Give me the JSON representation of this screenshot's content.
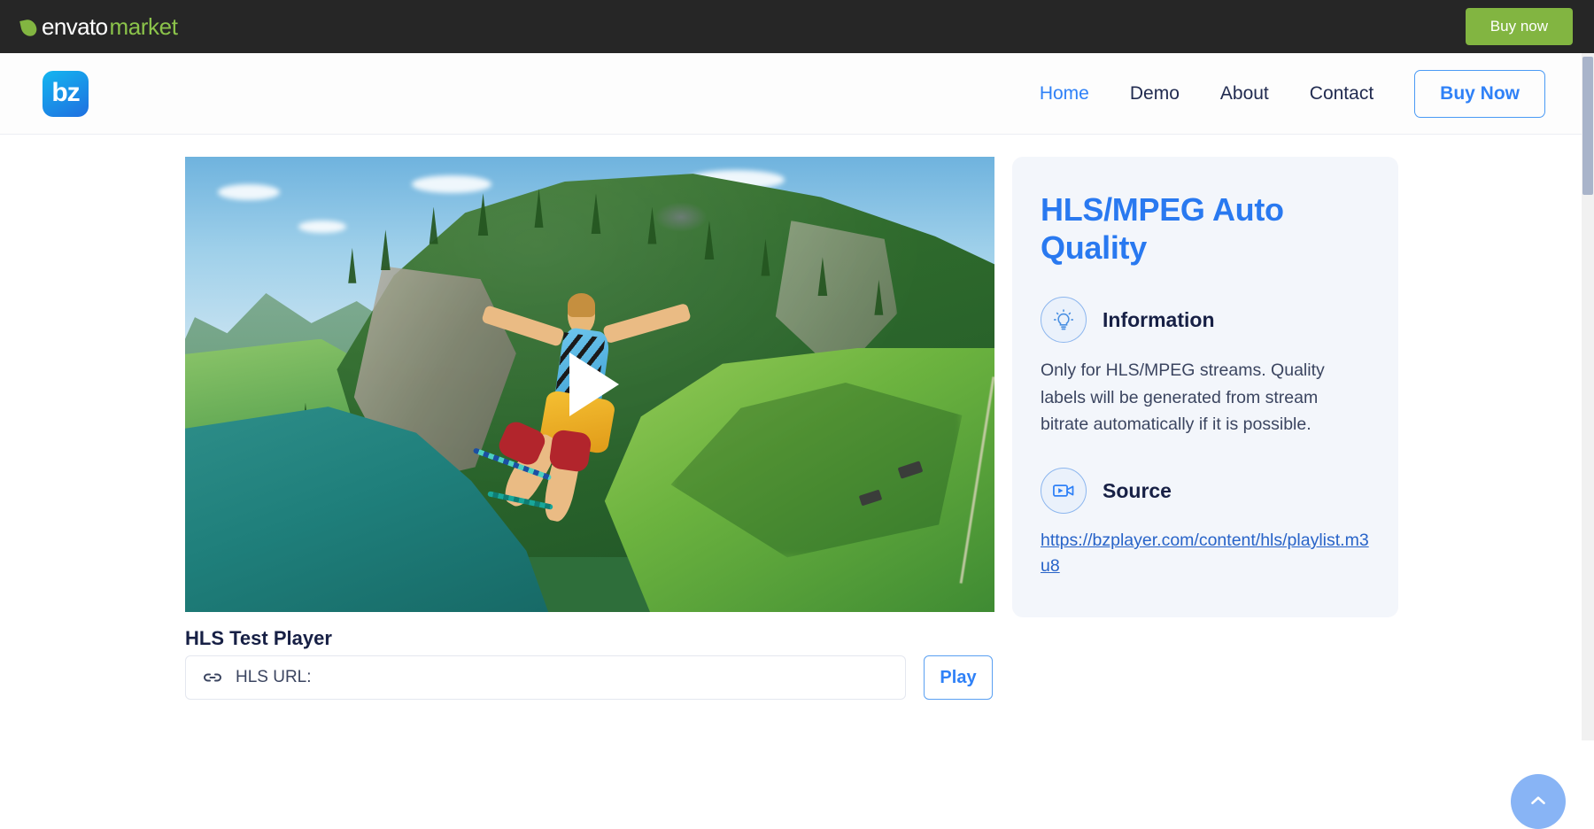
{
  "envato_bar": {
    "logo_word_1": "envato",
    "logo_word_2": "market",
    "logo_icon": "leaf-icon",
    "buy_now_label": "Buy now",
    "background_color": "#262626",
    "accent_color": "#82b541"
  },
  "header": {
    "brand_logo_text": "bz",
    "brand_logo_icon": "bz-logo-icon",
    "nav": [
      {
        "label": "Home",
        "active": true
      },
      {
        "label": "Demo",
        "active": false
      },
      {
        "label": "About",
        "active": false
      },
      {
        "label": "Contact",
        "active": false
      }
    ],
    "buy_now_label": "Buy Now",
    "accent_color": "#2f81f7",
    "text_color": "#212b50"
  },
  "video": {
    "alt": "bungee jumper over alpine lake",
    "play_icon": "play-triangle-icon"
  },
  "test_player": {
    "title": "HLS Test Player",
    "url_icon": "link-icon",
    "url_placeholder": "HLS URL:",
    "url_value": "",
    "play_button_label": "Play"
  },
  "info_panel": {
    "title": "HLS/MPEG Auto Quality",
    "title_color": "#2979f0",
    "background_color": "#f3f6fb",
    "sections": [
      {
        "icon": "lightbulb-icon",
        "label": "Information",
        "body": "Only for HLS/MPEG streams. Quality labels will be generated from stream bitrate automatically if it is possible."
      },
      {
        "icon": "video-camera-icon",
        "label": "Source",
        "link": "https://bzplayer.com/content/hls/playlist.m3u8"
      }
    ]
  },
  "scroll_top": {
    "icon": "chevron-up-icon",
    "color": "#88b4f5"
  }
}
